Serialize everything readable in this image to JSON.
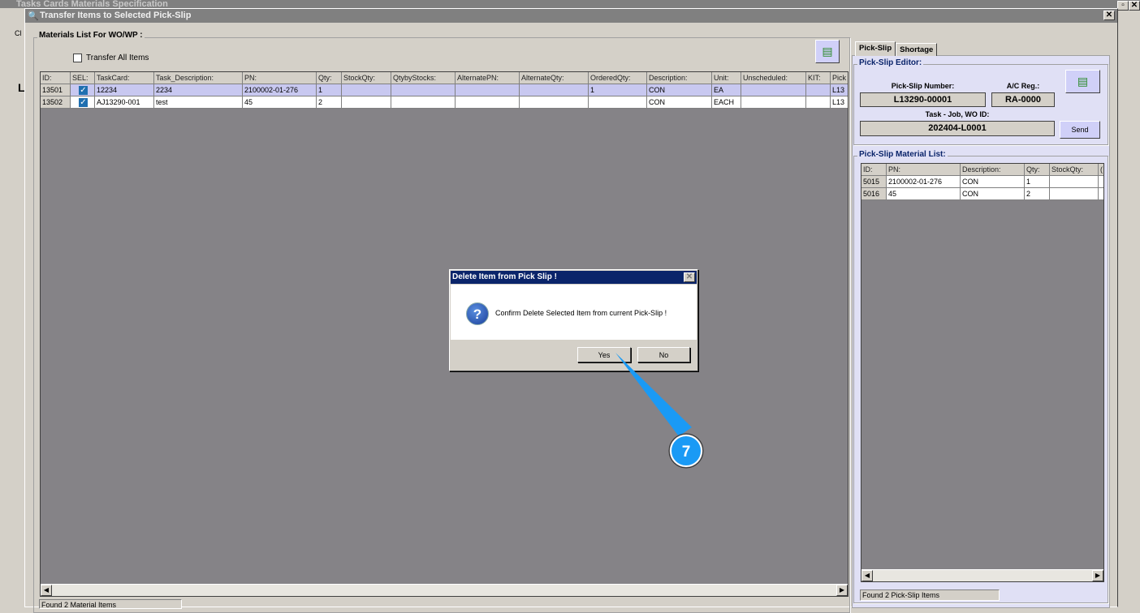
{
  "back_window": {
    "title": "Tasks Cards Materials Specification",
    "toolbar_label": "Cl",
    "side_label": "L"
  },
  "window": {
    "title": "Transfer Items to Selected Pick-Slip",
    "close": "✕"
  },
  "materials": {
    "group_label": "Materials List For WO/WP :",
    "transfer_all_label": "Transfer All Items",
    "columns": [
      "ID:",
      "SEL:",
      "TaskCard:",
      "Task_Description:",
      "PN:",
      "Qty:",
      "StockQty:",
      "QtybyStocks:",
      "AlternatePN:",
      "AlternateQty:",
      "OrderedQty:",
      "Description:",
      "Unit:",
      "Unscheduled:",
      "KIT:",
      "Pick"
    ],
    "rows": [
      [
        "13501",
        "",
        "12234",
        "2234",
        "2100002-01-276",
        "1",
        "",
        "",
        "",
        "",
        "1",
        "CON",
        "EA",
        "",
        "",
        "L13"
      ],
      [
        "13502",
        "",
        "AJ13290-001",
        "test",
        "45",
        "2",
        "",
        "",
        "",
        "",
        "",
        "CON",
        "EACH",
        "",
        "",
        "L13"
      ]
    ],
    "status": "Found 2 Material Items"
  },
  "tabs": [
    {
      "label": "Pick-Slip",
      "active": true
    },
    {
      "label": "Shortage",
      "active": false
    }
  ],
  "editor": {
    "group_label": "Pick-Slip Editor:",
    "pick_slip_number_label": "Pick-Slip Number:",
    "pick_slip_number": "L13290-00001",
    "ac_reg_label": "A/C Reg.:",
    "ac_reg": "RA-0000",
    "task_label": "Task - Job, WO ID:",
    "task_value": "202404-L0001",
    "send_label": "Send"
  },
  "pick_list": {
    "group_label": "Pick-Slip Material List:",
    "columns": [
      "ID:",
      "PN:",
      "Description:",
      "Qty:",
      "StockQty:",
      "("
    ],
    "rows": [
      [
        "5015",
        "2100002-01-276",
        "CON",
        "1",
        "",
        ""
      ],
      [
        "5016",
        "45",
        "CON",
        "2",
        "",
        ""
      ]
    ],
    "status": "Found 2 Pick-Slip Items"
  },
  "dialog": {
    "title": "Delete Item from Pick Slip !",
    "message": "Confirm Delete Selected Item from current Pick-Slip !",
    "yes": "Yes",
    "no": "No",
    "close": "✕",
    "icon": "?"
  },
  "callout": {
    "step": "7",
    "color": "#1a9af5"
  }
}
